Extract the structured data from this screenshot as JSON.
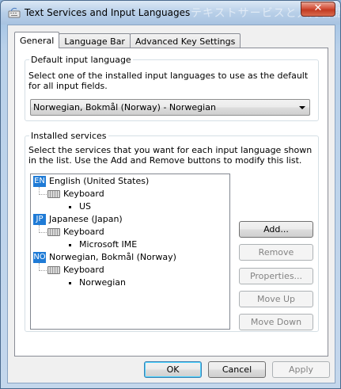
{
  "window": {
    "title": "Text Services and Input Languages",
    "title_background": "テキストサービスと入力言語の一覧"
  },
  "tabs": [
    {
      "label": "General",
      "active": true
    },
    {
      "label": "Language Bar",
      "active": false
    },
    {
      "label": "Advanced Key Settings",
      "active": false
    }
  ],
  "default_language": {
    "legend": "Default input language",
    "description": "Select one of the installed input languages to use as the default for all input fields.",
    "selected": "Norwegian, Bokmål (Norway) - Norwegian"
  },
  "installed_services": {
    "legend": "Installed services",
    "description": "Select the services that you want for each input language shown in the list. Use the Add and Remove buttons to modify this list.",
    "languages": [
      {
        "badge": "EN",
        "name": "English (United States)",
        "group": "Keyboard",
        "layout": "US"
      },
      {
        "badge": "JP",
        "name": "Japanese (Japan)",
        "group": "Keyboard",
        "layout": "Microsoft IME"
      },
      {
        "badge": "NO",
        "name": "Norwegian, Bokmål (Norway)",
        "group": "Keyboard",
        "layout": "Norwegian"
      }
    ],
    "buttons": {
      "add": "Add...",
      "remove": "Remove",
      "properties": "Properties...",
      "move_up": "Move Up",
      "move_down": "Move Down"
    }
  },
  "footer": {
    "ok": "OK",
    "cancel": "Cancel",
    "apply": "Apply"
  },
  "colors": {
    "badge": "#1f7bd6",
    "close_button": "#c23b22"
  }
}
